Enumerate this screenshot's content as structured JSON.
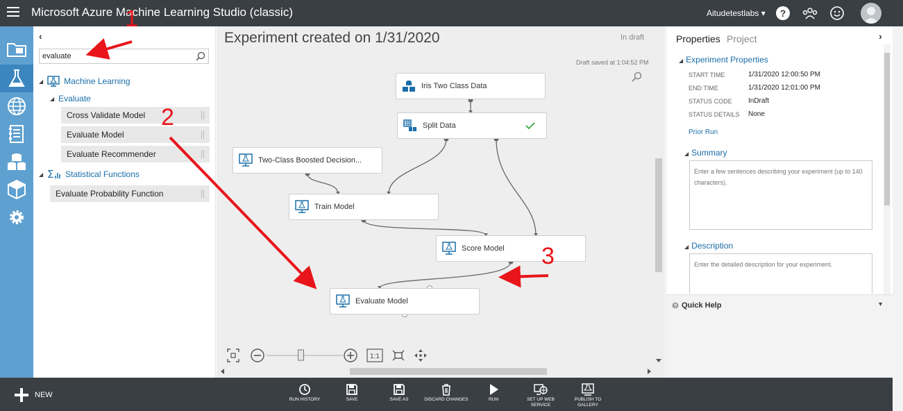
{
  "app": {
    "title": "Microsoft Azure Machine Learning Studio (classic)",
    "workspace": "Aitudetestlabs ▾"
  },
  "palette": {
    "search_value": "evaluate",
    "categories": [
      {
        "label": "Machine Learning"
      },
      {
        "label": "Evaluate"
      },
      {
        "label": "Statistical Functions"
      }
    ],
    "items": [
      {
        "label": "Cross Validate Model"
      },
      {
        "label": "Evaluate Model"
      },
      {
        "label": "Evaluate Recommender"
      },
      {
        "label": "Evaluate Probability Function"
      }
    ]
  },
  "canvas": {
    "title": "Experiment created on 1/31/2020",
    "status": "In draft",
    "draft_saved": "Draft saved at 1:04:52 PM",
    "modules": [
      {
        "label": "Iris Two Class Data",
        "icon": "dataset-icon"
      },
      {
        "label": "Split Data",
        "icon": "split-data-icon",
        "status": "completed"
      },
      {
        "label": "Two-Class Boosted Decision...",
        "icon": "model-icon"
      },
      {
        "label": "Train Model",
        "icon": "model-icon"
      },
      {
        "label": "Score Model",
        "icon": "model-icon"
      },
      {
        "label": "Evaluate Model",
        "icon": "model-icon"
      }
    ],
    "zoom_reset_label": "1:1",
    "zoom_level": 0.45
  },
  "properties": {
    "tabs": [
      "Properties",
      "Project"
    ],
    "section_experiment": "Experiment Properties",
    "fields": [
      {
        "label": "START TIME",
        "value": "1/31/2020 12:00:50 PM"
      },
      {
        "label": "END TIME",
        "value": "1/31/2020 12:01:00 PM"
      },
      {
        "label": "STATUS CODE",
        "value": "InDraft"
      },
      {
        "label": "STATUS DETAILS",
        "value": "None"
      }
    ],
    "prior_run": "Prior Run",
    "summary_title": "Summary",
    "summary_placeholder": "Enter a few sentences describing your experiment (up to 140 characters).",
    "description_title": "Description",
    "description_placeholder": "Enter the detailed description for your experiment.",
    "quick_help": "Quick Help"
  },
  "toolbar": {
    "new_label": "NEW",
    "commands": [
      {
        "label": "RUN HISTORY",
        "icon": "history-icon"
      },
      {
        "label": "SAVE",
        "icon": "save-icon"
      },
      {
        "label": "SAVE AS",
        "icon": "save-as-icon"
      },
      {
        "label": "DISCARD CHANGES",
        "icon": "trash-icon"
      },
      {
        "label": "RUN",
        "icon": "run-icon"
      },
      {
        "label": "SET UP WEB SERVICE",
        "icon": "web-service-icon"
      },
      {
        "label": "PUBLISH TO GALLERY",
        "icon": "gallery-icon"
      }
    ]
  },
  "annotations": {
    "step1": "1",
    "step2": "2",
    "step3": "3"
  },
  "colors": {
    "topbar": "#3a3f44",
    "nav": "#5ea0d0",
    "nav_active": "#3c86bf",
    "link": "#1a6ea8",
    "canvas": "#eeeeee",
    "annotation": "#e8151b",
    "success": "#4caf50"
  }
}
